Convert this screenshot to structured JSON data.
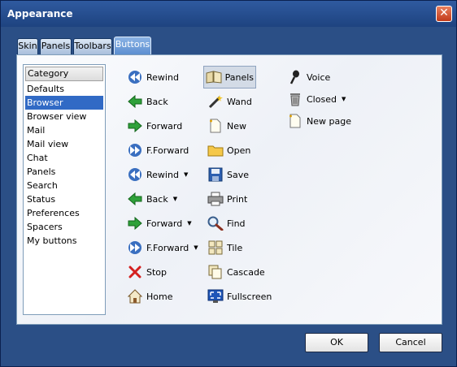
{
  "window": {
    "title": "Appearance"
  },
  "tabs": [
    {
      "label": "Skin"
    },
    {
      "label": "Panels"
    },
    {
      "label": "Toolbars"
    },
    {
      "label": "Buttons",
      "active": true
    }
  ],
  "category": {
    "header": "Category",
    "items": [
      "Defaults",
      "Browser",
      "Browser view",
      "Mail",
      "Mail view",
      "Chat",
      "Panels",
      "Search",
      "Status",
      "Preferences",
      "Spacers",
      "My buttons"
    ],
    "selected": "Browser"
  },
  "buttons": {
    "col1": [
      {
        "label": "Rewind",
        "icon": "rewind-icon"
      },
      {
        "label": "Back",
        "icon": "back-arrow-icon"
      },
      {
        "label": "Forward",
        "icon": "forward-arrow-icon"
      },
      {
        "label": "F.Forward",
        "icon": "fast-forward-icon"
      },
      {
        "label": "Rewind",
        "icon": "rewind-icon",
        "dropdown": true
      },
      {
        "label": "Back",
        "icon": "back-arrow-icon",
        "dropdown": true
      },
      {
        "label": "Forward",
        "icon": "forward-arrow-icon",
        "dropdown": true
      },
      {
        "label": "F.Forward",
        "icon": "fast-forward-icon",
        "dropdown": true
      },
      {
        "label": "Stop",
        "icon": "stop-icon"
      },
      {
        "label": "Home",
        "icon": "home-icon"
      }
    ],
    "col2": [
      {
        "label": "Panels",
        "icon": "panels-icon",
        "selected": true
      },
      {
        "label": "Wand",
        "icon": "wand-icon"
      },
      {
        "label": "New",
        "icon": "new-page-icon"
      },
      {
        "label": "Open",
        "icon": "folder-icon"
      },
      {
        "label": "Save",
        "icon": "floppy-icon"
      },
      {
        "label": "Print",
        "icon": "printer-icon"
      },
      {
        "label": "Find",
        "icon": "magnifier-icon"
      },
      {
        "label": "Tile",
        "icon": "tile-icon"
      },
      {
        "label": "Cascade",
        "icon": "cascade-icon"
      },
      {
        "label": "Fullscreen",
        "icon": "fullscreen-icon"
      }
    ],
    "col3": [
      {
        "label": "Voice",
        "icon": "voice-icon"
      },
      {
        "label": "Closed",
        "icon": "trash-icon",
        "dropdown": true
      },
      {
        "label": "New page",
        "icon": "new-page-icon"
      }
    ]
  },
  "footer": {
    "ok": "OK",
    "cancel": "Cancel"
  },
  "colors": {
    "titlebar": "#2b4f86",
    "selection": "#316ac5",
    "close": "#d6532f"
  }
}
